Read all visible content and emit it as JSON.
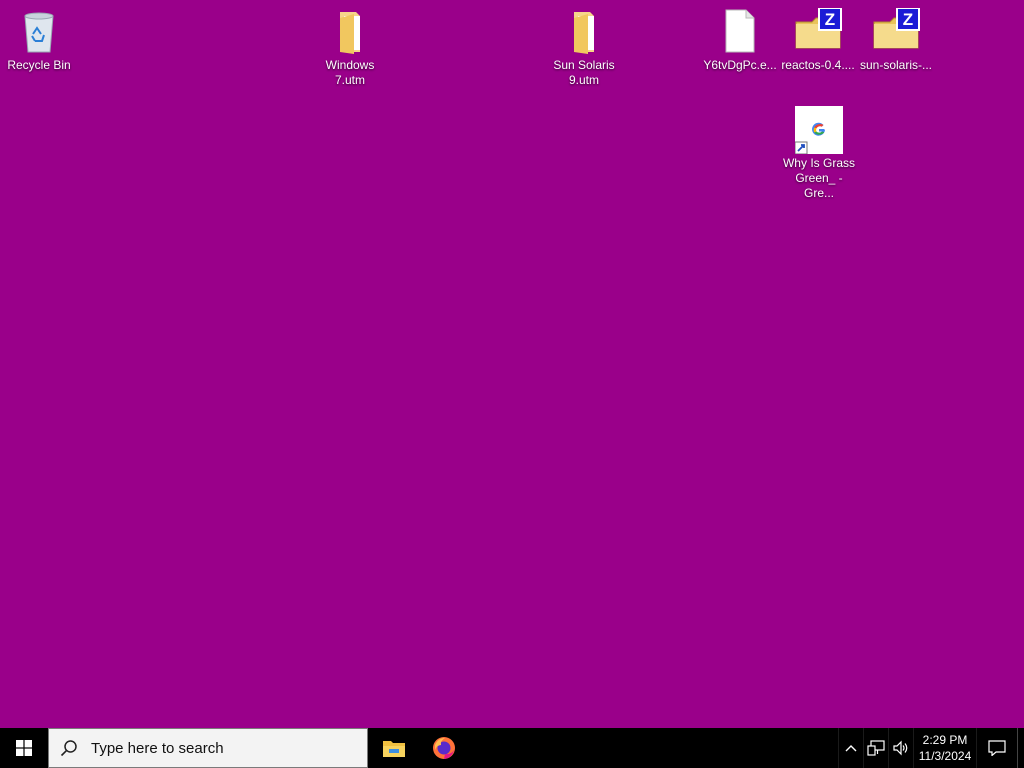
{
  "desktop": {
    "background": "#9a008a",
    "icons": [
      {
        "label": "Recycle Bin",
        "type": "recycle-bin"
      },
      {
        "label": "Windows\n7.utm",
        "type": "folder"
      },
      {
        "label": "Sun Solaris\n9.utm",
        "type": "folder"
      },
      {
        "label": "Y6tvDgPc.e...",
        "type": "file"
      },
      {
        "label": "reactos-0.4....",
        "type": "zip-folder"
      },
      {
        "label": "sun-solaris-...",
        "type": "zip-folder"
      },
      {
        "label": "Why Is Grass\nGreen_ - Gre...",
        "type": "google-shortcut"
      }
    ]
  },
  "taskbar": {
    "search": {
      "placeholder": "Type here to search"
    },
    "pinned": [
      "file-explorer-icon",
      "firefox-icon"
    ],
    "clock": {
      "time": "2:29 PM",
      "date": "11/3/2024"
    }
  }
}
